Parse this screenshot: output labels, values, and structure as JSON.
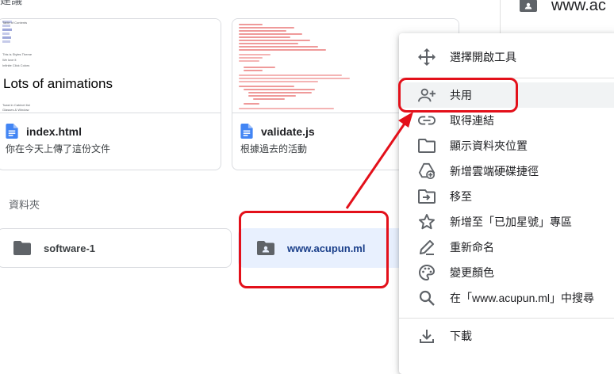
{
  "header": {
    "clipped_heading": "建議"
  },
  "files": [
    {
      "name": "index.html",
      "subtitle": "你在今天上傳了這份文件",
      "preview_heading": "Lots of animations",
      "preview_lines": [
        "Table of Contents",
        "Lots of animations",
        "This is Styles Theme",
        "We love it",
        "Infinite Click Colors",
        "Toast in Cabinet list",
        "Glasses & Window"
      ]
    },
    {
      "name": "validate.js",
      "subtitle": "根據過去的活動"
    }
  ],
  "folders_section": {
    "label": "資料夾",
    "items": [
      {
        "name": "software-1",
        "icon": "folder-icon",
        "selected": false
      },
      {
        "name": "www.acupun.ml",
        "icon": "shared-folder-icon",
        "selected": true
      }
    ]
  },
  "side_panel": {
    "title": "www.ac"
  },
  "context_menu": {
    "items": [
      {
        "label": "選擇開啟工具",
        "icon": "open-with-icon"
      },
      {
        "label": "共用",
        "icon": "share-person-add-icon",
        "highlighted": true
      },
      {
        "label": "取得連結",
        "icon": "link-icon"
      },
      {
        "label": "顯示資料夾位置",
        "icon": "folder-outline-icon"
      },
      {
        "label": "新增雲端硬碟捷徑",
        "icon": "add-shortcut-icon"
      },
      {
        "label": "移至",
        "icon": "move-to-icon"
      },
      {
        "label": "新增至「已加星號」專區",
        "icon": "star-icon"
      },
      {
        "label": "重新命名",
        "icon": "rename-pencil-icon"
      },
      {
        "label": "變更顏色",
        "icon": "palette-icon"
      },
      {
        "label": "在「www.acupun.ml」中搜尋",
        "icon": "search-icon"
      },
      {
        "label": "下載",
        "icon": "download-icon"
      }
    ]
  },
  "colors": {
    "annotation_red": "#e3101a",
    "file_blue": "#4285f4",
    "selected_bg": "#e8f0fe"
  }
}
